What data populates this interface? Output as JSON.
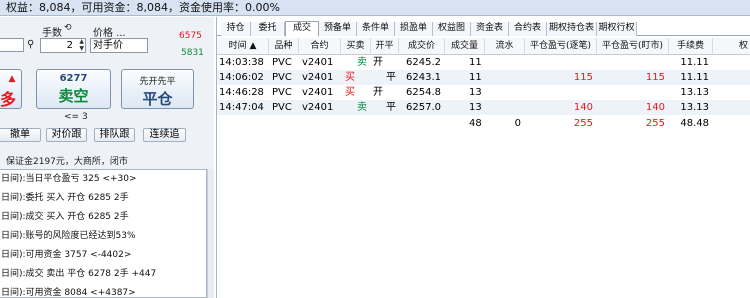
{
  "topbar": {
    "status_text": "权益：8,084，可用资金：8,084，资金使用率：0.00%"
  },
  "order_panel": {
    "qty_label": "手数",
    "qty_value": "2",
    "price_label": "价格 ...",
    "price_value": "对手价",
    "ask_price": "6575",
    "bid_price": "5831",
    "buy_partial_label": "多",
    "sell_price": "6277",
    "sell_label": "卖空",
    "close_label_top": "先开先平",
    "close_label": "平仓",
    "hint": "<= 3",
    "buttons": [
      "撤单",
      "对价跟",
      "排队跟",
      "连续追"
    ],
    "margin_info": "保证金2197元，大商所，闭市"
  },
  "log": [
    "日间):当日平仓盈亏 325 <+30>",
    "日间):委托 买入 开仓 6285 2手",
    "日间):成交 买入 开仓 6285 2手",
    "日间):账号的风险度已经达到53%",
    "日间):可用资金 3757 <-4402>",
    "日间):成交 卖出 平仓 6278 2手 +447",
    "日间):可用资金 8084 <+4387>"
  ],
  "tabs": [
    "持仓",
    "委托",
    "成交",
    "预备单",
    "条件单",
    "损盈单",
    "权益图",
    "资金表",
    "合约表",
    "期权持仓表",
    "期权行权"
  ],
  "active_tab": "成交",
  "table": {
    "columns": [
      "时间 ▲",
      "品种",
      "合约",
      "买卖",
      "开平",
      "成交价",
      "成交量",
      "流水",
      "平仓盈亏(逐笔)",
      "平仓盈亏(盯市)",
      "手续费",
      "权"
    ],
    "rows": [
      {
        "time": "14:03:38",
        "product": "PVC",
        "contract": "v2401",
        "side": "卖",
        "oc": "开",
        "price": "6245.2",
        "qty": "11",
        "flow": "",
        "pnl_trade": "",
        "pnl_mark": "",
        "fee": "11.11"
      },
      {
        "time": "14:06:02",
        "product": "PVC",
        "contract": "v2401",
        "side": "买",
        "oc": "平",
        "price": "6243.1",
        "qty": "11",
        "flow": "",
        "pnl_trade": "115",
        "pnl_mark": "115",
        "fee": "11.11"
      },
      {
        "time": "14:46:28",
        "product": "PVC",
        "contract": "v2401",
        "side": "买",
        "oc": "开",
        "price": "6254.8",
        "qty": "13",
        "flow": "",
        "pnl_trade": "",
        "pnl_mark": "",
        "fee": "13.13"
      },
      {
        "time": "14:47:04",
        "product": "PVC",
        "contract": "v2401",
        "side": "卖",
        "oc": "平",
        "price": "6257.0",
        "qty": "13",
        "flow": "",
        "pnl_trade": "140",
        "pnl_mark": "140",
        "fee": "13.13"
      }
    ],
    "totals": {
      "qty": "48",
      "flow": "0",
      "pnl_trade": "255",
      "pnl_mark": "255",
      "fee": "48.48"
    }
  },
  "colors": {
    "buy": "#e21b1b",
    "sell": "#0a8a3a",
    "accent": "#d7e3f2"
  }
}
